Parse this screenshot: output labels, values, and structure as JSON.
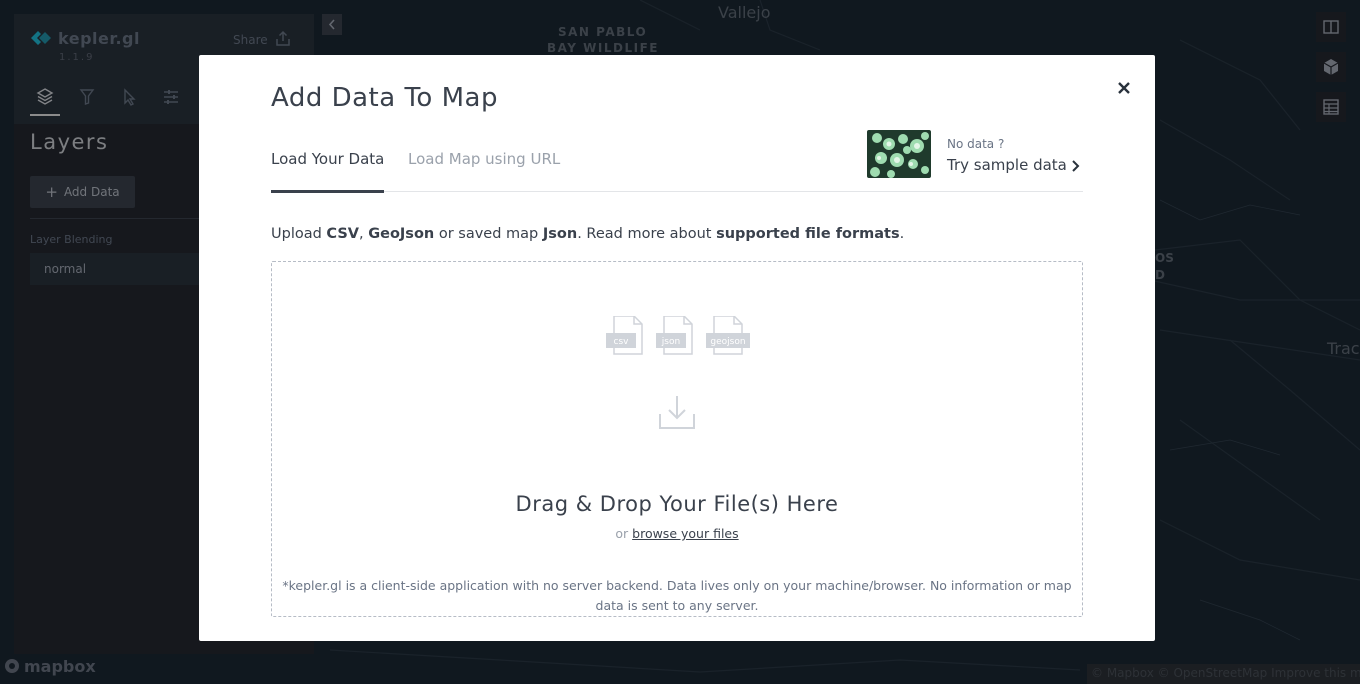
{
  "app": {
    "name": "kepler.gl",
    "version": "1.1.9",
    "share_label": "Share"
  },
  "sidepanel": {
    "title": "Layers",
    "add_data_label": "Add Data",
    "layer_blending_label": "Layer Blending",
    "layer_blending_value": "normal",
    "tabs": [
      "layers-icon",
      "filter-icon",
      "interaction-icon",
      "map-settings-icon"
    ]
  },
  "map": {
    "labels": [
      "Vallejo",
      "SAN PABLO",
      "BAY WILDLIFE",
      "OS",
      "D",
      "Trac"
    ],
    "mapbox_logo": "mapbox",
    "attribution": "© Mapbox © OpenStreetMap Improve this map"
  },
  "modal": {
    "title": "Add Data To Map",
    "tabs": [
      {
        "label": "Load Your Data",
        "active": true
      },
      {
        "label": "Load Map using URL",
        "active": false
      }
    ],
    "sample": {
      "small": "No data ?",
      "big": "Try sample data"
    },
    "upload": {
      "prefix": "Upload ",
      "csv": "CSV",
      "sep": ", ",
      "geojson": "GeoJson",
      "middle": " or saved map ",
      "json": "Json",
      "read_more": ". Read more about ",
      "link": "supported file formats",
      "end": "."
    },
    "file_types": [
      "csv",
      "json",
      "geojson"
    ],
    "drop_title": "Drag & Drop Your File(s) Here",
    "browse_or": "or ",
    "browse_link": "browse your files",
    "disclaimer": "*kepler.gl is a client-side application with no server backend. Data lives only on your machine/browser. No information or map data is sent to any server."
  },
  "colors": {
    "map_bg": "#1b2733",
    "panel_bg": "#242730",
    "modal_bg": "#ffffff",
    "text_dark": "#3a414c",
    "logo_accent": "#1fbad6"
  }
}
